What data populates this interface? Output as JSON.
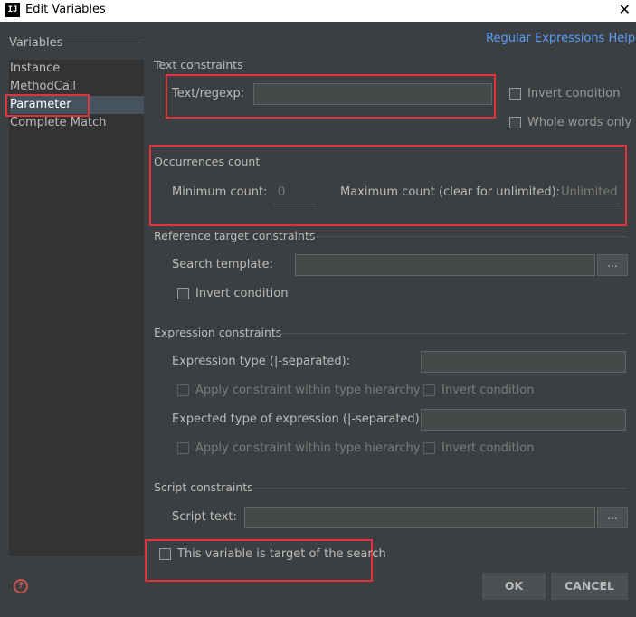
{
  "window": {
    "title": "Edit Variables",
    "icon_glyph": "IJ",
    "close_glyph": "✕"
  },
  "sidebar": {
    "header": "Variables",
    "items": [
      {
        "label": "Instance"
      },
      {
        "label": "MethodCall"
      },
      {
        "label": "Parameter"
      },
      {
        "label": "Complete Match"
      }
    ],
    "selected": "Parameter"
  },
  "help_link": "Regular Expressions Help",
  "text_constraints": {
    "title": "Text constraints",
    "regexp_label": "Text/regexp:",
    "regexp_value": "",
    "invert_label": "Invert condition",
    "whole_words_label": "Whole words only"
  },
  "occurrences": {
    "title": "Occurrences count",
    "min_label": "Minimum count:",
    "min_value": "0",
    "max_label": "Maximum count (clear for unlimited):",
    "max_value": "Unlimited"
  },
  "reference": {
    "title": "Reference target constraints",
    "search_template_label": "Search template:",
    "browse_label": "...",
    "invert_label": "Invert condition"
  },
  "expression": {
    "title": "Expression constraints",
    "type_label": "Expression type (|-separated):",
    "apply_hierarchy_label_1": "Apply constraint within type hierarchy",
    "invert_label_1": "Invert condition",
    "expected_label": "Expected type of expression (|-separated):",
    "apply_hierarchy_label_2": "Apply constraint within type hierarchy",
    "invert_label_2": "Invert condition"
  },
  "script": {
    "title": "Script constraints",
    "text_label": "Script text:",
    "browse_label": "..."
  },
  "target_checkbox_label": "This variable is target of the search",
  "buttons": {
    "ok": "OK",
    "cancel": "CANCEL",
    "help_glyph": "?"
  },
  "colors": {
    "background": "#3c3f41",
    "highlight_box": "#e0343c",
    "link": "#589df6"
  }
}
